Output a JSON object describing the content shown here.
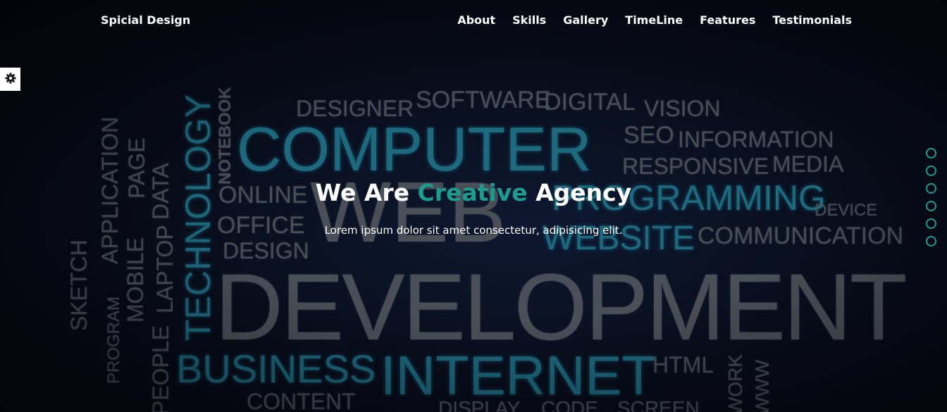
{
  "nav": {
    "brand": "Spicial Design",
    "links": [
      "About",
      "Skills",
      "Gallery",
      "TimeLine",
      "Features",
      "Testimonials"
    ]
  },
  "hero": {
    "title_pre": "We Are ",
    "title_accent": "Creative",
    "title_post": " Agency",
    "subtitle": "Lorem ipsum dolor sit amet consectetur, adipisicing elit."
  },
  "background_words": [
    "DESIGNER",
    "SOFTWARE",
    "DIGITAL",
    "VISION",
    "COMPUTER",
    "SEO",
    "INFORMATION",
    "RESPONSIVE",
    "MEDIA",
    "ONLINE",
    "PROGRAMMING",
    "DEVICE",
    "WEB",
    "OFFICE",
    "DESIGN",
    "WEBSITE",
    "COMMUNICATION",
    "DEVELOPMENT",
    "BUSINESS",
    "INTERNET",
    "HTML",
    "CONTENT",
    "DISPLAY",
    "CODE",
    "SCREEN",
    "TECHNOLOGY",
    "NOTEBOOK",
    "APPLICATION",
    "PAGE",
    "DATA",
    "LAPTOP",
    "MOBILE",
    "SKETCH",
    "PROGRAM",
    "PEOPLE",
    "WORK",
    "WWW"
  ],
  "colors": {
    "accent": "#1c9c8e",
    "background": "#05070f"
  },
  "icons": {
    "settings": "gear-icon",
    "pager": "slide-bullet"
  }
}
